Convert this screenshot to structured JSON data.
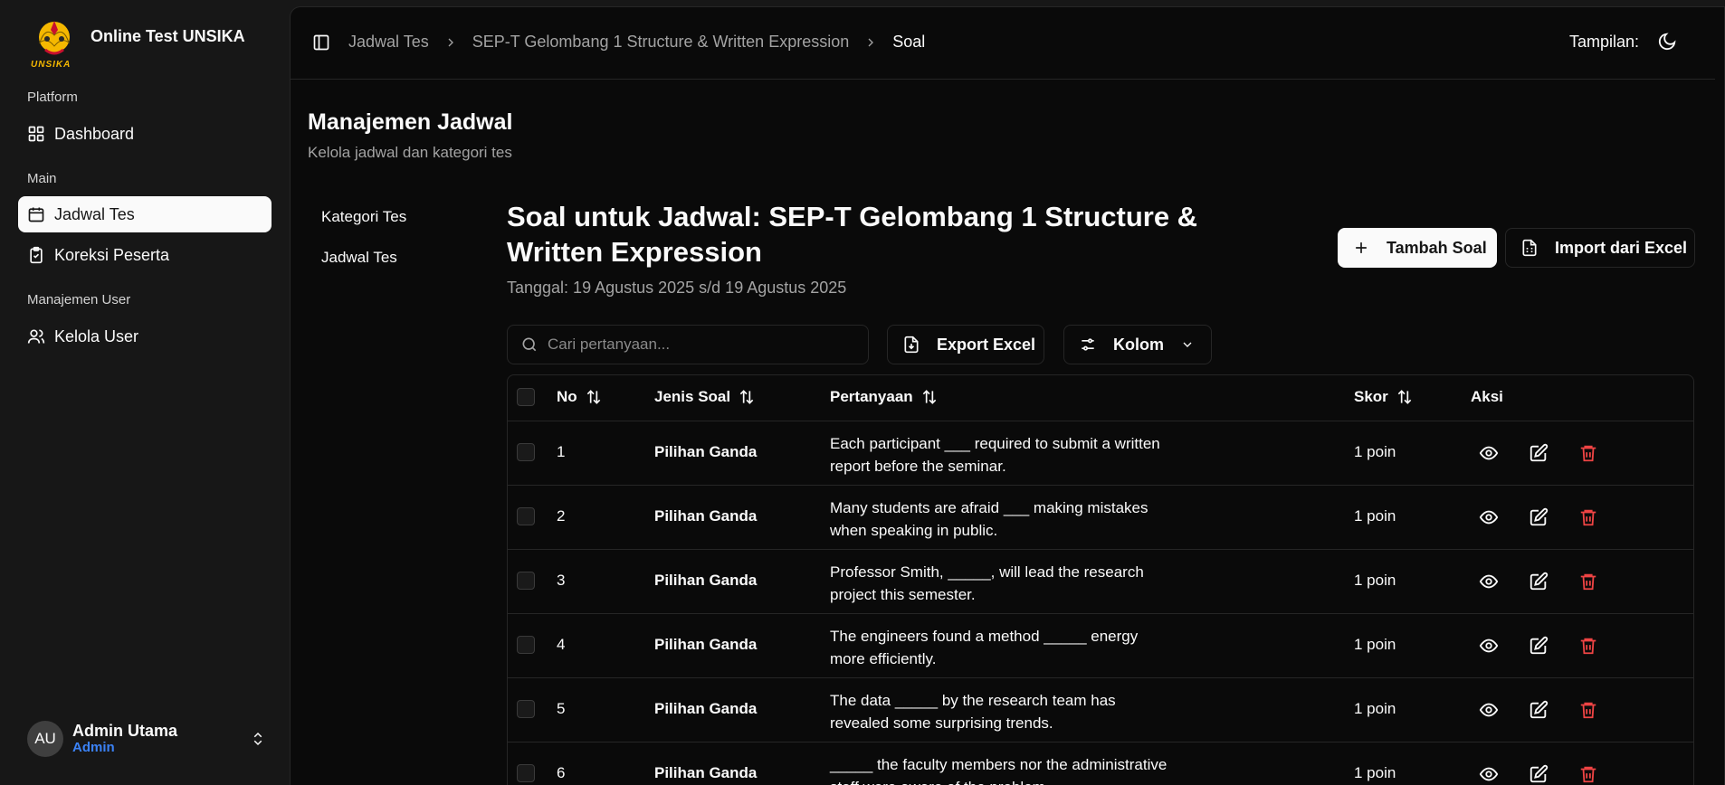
{
  "app": {
    "title": "Online Test UNSIKA",
    "logo_text": "UNSIKA"
  },
  "sidebar": {
    "groups": [
      {
        "label": "Platform"
      },
      {
        "label": "Main"
      },
      {
        "label": "Manajemen User"
      }
    ],
    "items": [
      {
        "label": "Dashboard",
        "icon": "grid-icon"
      },
      {
        "label": "Jadwal Tes",
        "icon": "calendar-icon",
        "active": true
      },
      {
        "label": "Koreksi Peserta",
        "icon": "clipboard-check-icon"
      },
      {
        "label": "Kelola User",
        "icon": "users-icon"
      }
    ],
    "user": {
      "initials": "AU",
      "name": "Admin Utama",
      "role": "Admin"
    }
  },
  "topbar": {
    "breadcrumbs": [
      "Jadwal Tes",
      "SEP-T Gelombang 1 Structure & Written Expression",
      "Soal"
    ],
    "theme_label": "Tampilan:"
  },
  "page": {
    "title": "Manajemen Jadwal",
    "subtitle": "Kelola jadwal dan kategori tes",
    "subnav": [
      "Kategori Tes",
      "Jadwal Tes"
    ]
  },
  "schedule": {
    "title": "Soal untuk Jadwal: SEP-T Gelombang 1 Structure & Written Expression",
    "date": "Tanggal: 19 Agustus 2025 s/d 19 Agustus 2025",
    "add_button": "Tambah Soal",
    "import_button": "Import dari Excel",
    "export_button": "Export Excel",
    "columns_button": "Kolom",
    "search_placeholder": "Cari pertanyaan..."
  },
  "table": {
    "headers": {
      "no": "No",
      "type": "Jenis Soal",
      "question": "Pertanyaan",
      "score": "Skor",
      "actions": "Aksi"
    },
    "rows": [
      {
        "no": "1",
        "type": "Pilihan Ganda",
        "question": "Each participant ___ required to submit a written report before the seminar.",
        "score": "1 poin"
      },
      {
        "no": "2",
        "type": "Pilihan Ganda",
        "question": "Many students are afraid ___ making mistakes when speaking in public.",
        "score": "1 poin"
      },
      {
        "no": "3",
        "type": "Pilihan Ganda",
        "question": "Professor Smith, _____, will lead the research project this semester.",
        "score": "1 poin"
      },
      {
        "no": "4",
        "type": "Pilihan Ganda",
        "question": "The engineers found a method _____ energy more efficiently.",
        "score": "1 poin"
      },
      {
        "no": "5",
        "type": "Pilihan Ganda",
        "question": "The data _____ by the research team has revealed some surprising trends.",
        "score": "1 poin"
      },
      {
        "no": "6",
        "type": "Pilihan Ganda",
        "question": "_____ the faculty members nor the administrative staff were aware of the problem.",
        "score": "1 poin"
      }
    ]
  },
  "colors": {
    "accent_role": "#3b82f6",
    "danger": "#ef4444",
    "bg": "#0a0a0a"
  }
}
